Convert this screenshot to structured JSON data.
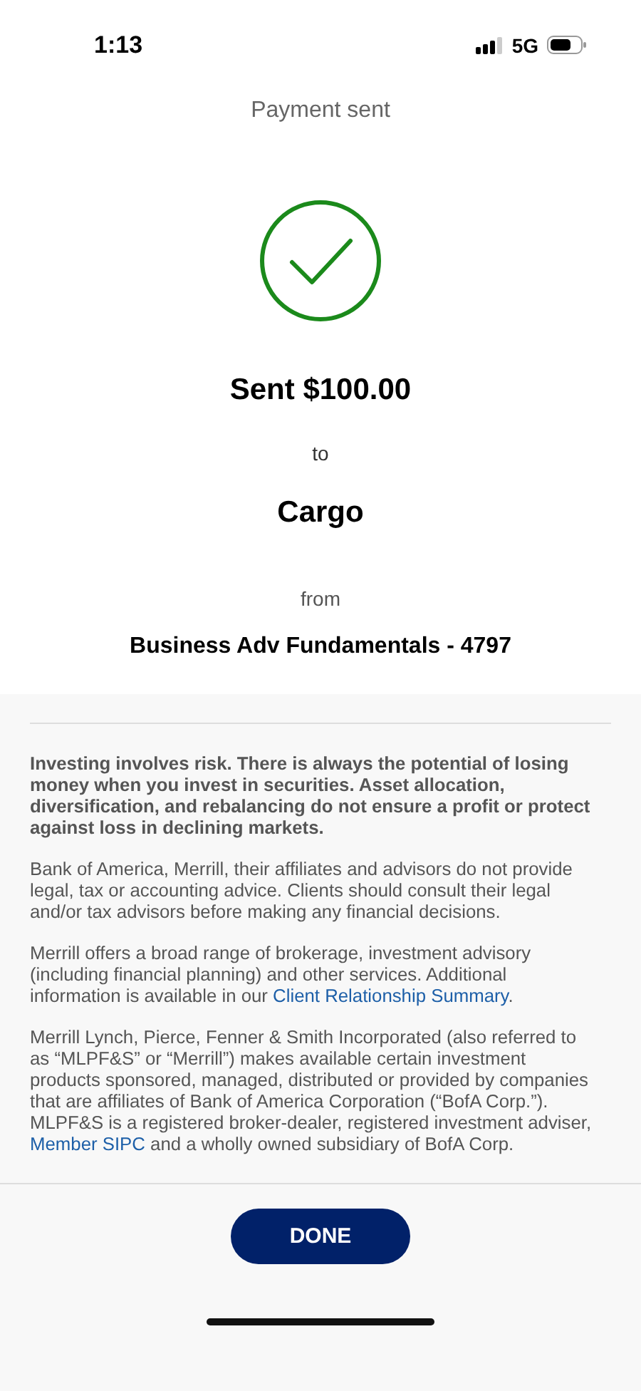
{
  "status_bar": {
    "time": "1:13",
    "network": "5G"
  },
  "header": {
    "title": "Payment sent"
  },
  "confirmation": {
    "amount_line": "Sent $100.00",
    "to_label": "to",
    "recipient": "Cargo",
    "from_label": "from",
    "account": "Business Adv Fundamentals - 4797"
  },
  "disclosures": [
    {
      "kind": "emphasis",
      "parts": [
        {
          "text": "Investing involves risk. There is always the potential of losing money when you invest in securities. Asset allocation, diversification, and rebalancing do not ensure a profit or protect against loss in declining markets.",
          "link": false
        }
      ]
    },
    {
      "kind": "plain",
      "parts": [
        {
          "text": "Bank of America, Merrill, their affiliates and advisors do not provide legal, tax or accounting advice. Clients should consult their legal and/or tax advisors before making any financial decisions.",
          "link": false
        }
      ]
    },
    {
      "kind": "plain",
      "parts": [
        {
          "text": "Merrill offers a broad range of brokerage, investment advisory (including financial planning) and other services. Additional information is available in our ",
          "link": false
        },
        {
          "text": "Client Relationship Summary",
          "link": true
        },
        {
          "text": ".",
          "link": false
        }
      ]
    },
    {
      "kind": "plain",
      "parts": [
        {
          "text": "Merrill Lynch, Pierce, Fenner & Smith Incorporated (also referred to as “MLPF&S” or “Merrill”) makes available certain investment products sponsored, managed, distributed or provided by companies that are affiliates of Bank of America Corporation (“BofA Corp.”). MLPF&S is a registered broker-dealer, registered investment adviser, ",
          "link": false
        },
        {
          "text": "Member SIPC",
          "link": true
        },
        {
          "text": " and a wholly owned subsidiary of BofA Corp.",
          "link": false
        }
      ]
    }
  ],
  "done_button": "DONE"
}
